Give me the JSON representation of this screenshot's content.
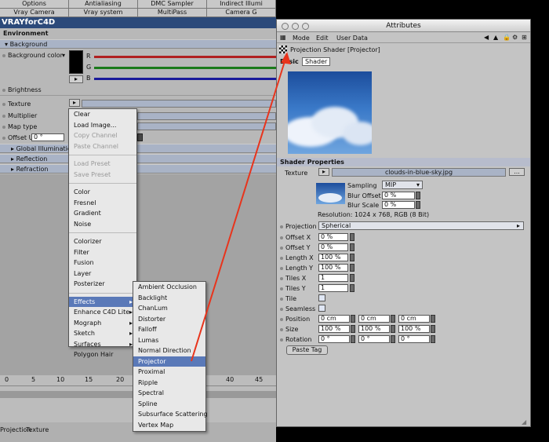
{
  "left_panel": {
    "tabs_row1": [
      "Options",
      "Antialiasing",
      "DMC Sampler",
      "Indirect Illumi"
    ],
    "tabs_row2": [
      "Vray Camera",
      "Vray system",
      "MultiPass",
      "Camera G"
    ],
    "logo": "VRAYforC4D",
    "environment_label": "Environment",
    "background_group": "Background",
    "background_color_label": "Background color",
    "rgb_labels": [
      "R",
      "G",
      "B"
    ],
    "brightness_label": "Brightness",
    "texture_label": "Texture",
    "multiplier_label": "Multiplier",
    "map_type_label": "Map type",
    "offset_u_label": "Offset U",
    "offset_u_value": "0 °",
    "groups": [
      "Global Illumination",
      "Reflection",
      "Refraction"
    ],
    "bottom_tabs": [
      "Projection",
      "Texture"
    ]
  },
  "context_menu": {
    "items": [
      {
        "label": "Clear",
        "disabled": false
      },
      {
        "label": "Load Image...",
        "disabled": false
      },
      {
        "label": "Copy Channel",
        "disabled": true
      },
      {
        "label": "Paste Channel",
        "disabled": true
      },
      {
        "label": "Load Preset",
        "disabled": true
      },
      {
        "label": "Save Preset",
        "disabled": true
      },
      {
        "label": "Color",
        "disabled": false
      },
      {
        "label": "Fresnel",
        "disabled": false
      },
      {
        "label": "Gradient",
        "disabled": false
      },
      {
        "label": "Noise",
        "disabled": false
      },
      {
        "label": "Colorizer",
        "disabled": false
      },
      {
        "label": "Filter",
        "disabled": false
      },
      {
        "label": "Fusion",
        "disabled": false
      },
      {
        "label": "Layer",
        "disabled": false
      },
      {
        "label": "Posterizer",
        "disabled": false
      },
      {
        "label": "Effects",
        "disabled": false
      },
      {
        "label": "Enhance C4D Lite",
        "disabled": false
      },
      {
        "label": "Mograph",
        "disabled": false
      },
      {
        "label": "Sketch",
        "disabled": false
      },
      {
        "label": "Surfaces",
        "disabled": false
      },
      {
        "label": "Polygon Hair",
        "disabled": false
      }
    ]
  },
  "effects_submenu": {
    "items": [
      "Ambient Occlusion",
      "Backlight",
      "ChanLum",
      "Distorter",
      "Falloff",
      "Lumas",
      "Normal Direction",
      "Projector",
      "Proximal",
      "Ripple",
      "Spectral",
      "Spline",
      "Subsurface Scattering",
      "Vertex Map"
    ],
    "selected": "Projector"
  },
  "timeline": {
    "ticks": [
      "0",
      "5",
      "10",
      "15",
      "20",
      "25",
      "30",
      "35",
      "40",
      "45"
    ]
  },
  "attributes": {
    "title": "Attributes",
    "menu": [
      "Mode",
      "Edit",
      "User Data"
    ],
    "object_name": "Projection Shader [Projector]",
    "tabs": [
      "Basic",
      "Shader"
    ],
    "shader_properties_label": "Shader Properties",
    "texture_label": "Texture",
    "texture_file": "clouds-in-blue-sky.jpg",
    "browse_label": "...",
    "sampling_label": "Sampling",
    "sampling_value": "MIP",
    "blur_offset_label": "Blur Offset",
    "blur_offset_value": "0 %",
    "blur_scale_label": "Blur Scale",
    "blur_scale_value": "0 %",
    "resolution": "Resolution: 1024 x 768, RGB (8 Bit)",
    "projection_label": "Projection",
    "projection_value": "Spherical",
    "offset_x_label": "Offset X",
    "offset_x_value": "0 %",
    "offset_y_label": "Offset Y",
    "offset_y_value": "0 %",
    "length_x_label": "Length X",
    "length_x_value": "100 %",
    "length_y_label": "Length Y",
    "length_y_value": "100 %",
    "tiles_x_label": "Tiles X",
    "tiles_x_value": "1",
    "tiles_y_label": "Tiles Y",
    "tiles_y_value": "1",
    "tile_label": "Tile",
    "seamless_label": "Seamless",
    "position_label": "Position",
    "position_values": [
      "0 cm",
      "0 cm",
      "0 cm"
    ],
    "size_label": "Size",
    "size_values": [
      "100 %",
      "100 %",
      "100 %"
    ],
    "rotation_label": "Rotation",
    "rotation_values": [
      "0 °",
      "0 °",
      "0 °"
    ],
    "paste_tag_label": "Paste Tag"
  },
  "colors": {
    "accent_blue": "#2c4a7a",
    "menu_highlight": "#5a79b8",
    "arrow_red": "#e8341c",
    "group_bar": "#a9b3c6"
  }
}
